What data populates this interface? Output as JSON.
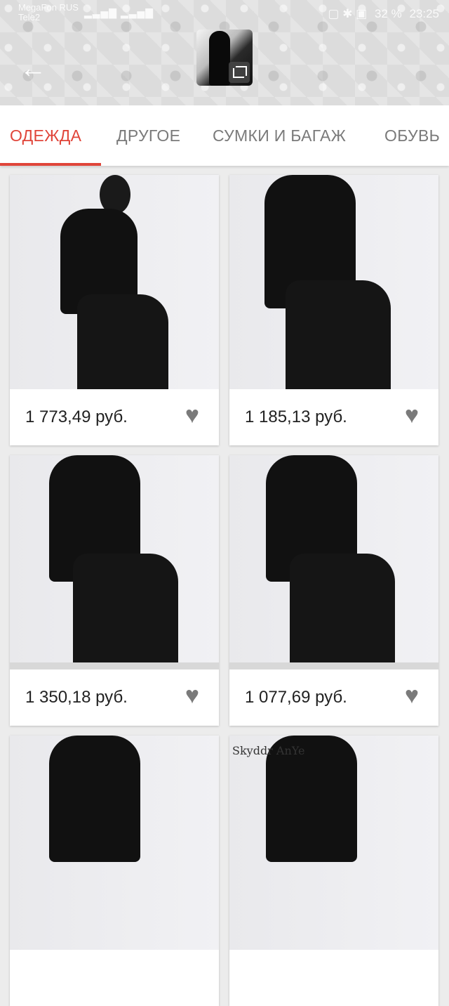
{
  "status_bar": {
    "carrier": "MegaFon RUS\nTele2",
    "signal": "▂▃▅▇ ▂▃▅▇",
    "icons": "▢ ✱ ▣",
    "battery": "32 %",
    "time": "23:25"
  },
  "header": {
    "back_icon": "arrow-left-icon",
    "thumbnail_icon": "crop-icon"
  },
  "tabs": [
    {
      "label": "ОДЕЖДА",
      "active": true
    },
    {
      "label": "ДРУГОЕ",
      "active": false
    },
    {
      "label": "СУМКИ И БАГАЖ",
      "active": false
    },
    {
      "label": "ОБУВЬ",
      "active": false
    }
  ],
  "products": [
    {
      "price": "1 773,49 руб."
    },
    {
      "price": "1 185,13 руб."
    },
    {
      "price": "1 350,18 руб."
    },
    {
      "price": "1 077,69 руб."
    },
    {
      "price": ""
    },
    {
      "price": "",
      "watermark": "Skyddr AnYe"
    }
  ],
  "colors": {
    "accent": "#e0453a",
    "tab_inactive": "#7a7a7a",
    "heart": "#7a7a7a",
    "background": "#ececec"
  }
}
